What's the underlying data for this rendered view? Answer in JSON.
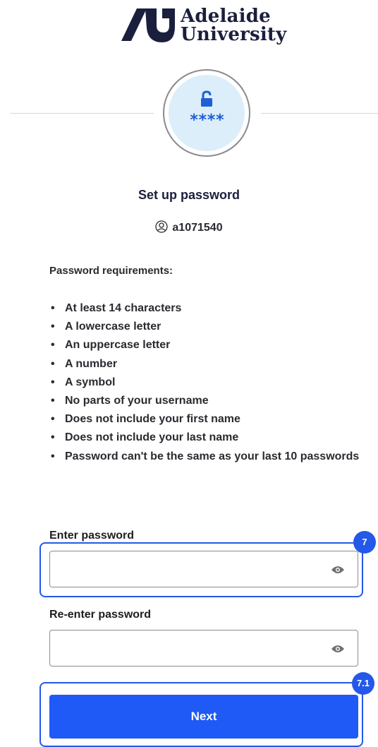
{
  "brand": {
    "name_line1": "Adelaide",
    "name_line2": "University"
  },
  "header": {
    "badge_text": "****"
  },
  "title": "Set up password",
  "username": "a1071540",
  "requirements": {
    "heading": "Password requirements:",
    "items": [
      "At least 14 characters",
      "A lowercase letter",
      "An uppercase letter",
      "A number",
      "A symbol",
      "No parts of your username",
      "Does not include your first name",
      "Does not include your last name",
      "Password can't be the same as your last 10 passwords"
    ]
  },
  "fields": {
    "password_label": "Enter password",
    "password_value": "",
    "confirm_label": "Re-enter password",
    "confirm_value": ""
  },
  "buttons": {
    "next_label": "Next"
  },
  "annotations": {
    "step_1": "7",
    "step_2": "7.1"
  },
  "icons": {
    "logo": "adelaide-university-logo",
    "badge": "unlock-icon",
    "user": "user-icon",
    "toggle": "eye-icon"
  },
  "colors": {
    "brand_navy": "#1a1f3d",
    "primary_blue": "#1f5af6",
    "highlight_blue": "#2458e8",
    "badge_bg": "#dbeefa"
  }
}
